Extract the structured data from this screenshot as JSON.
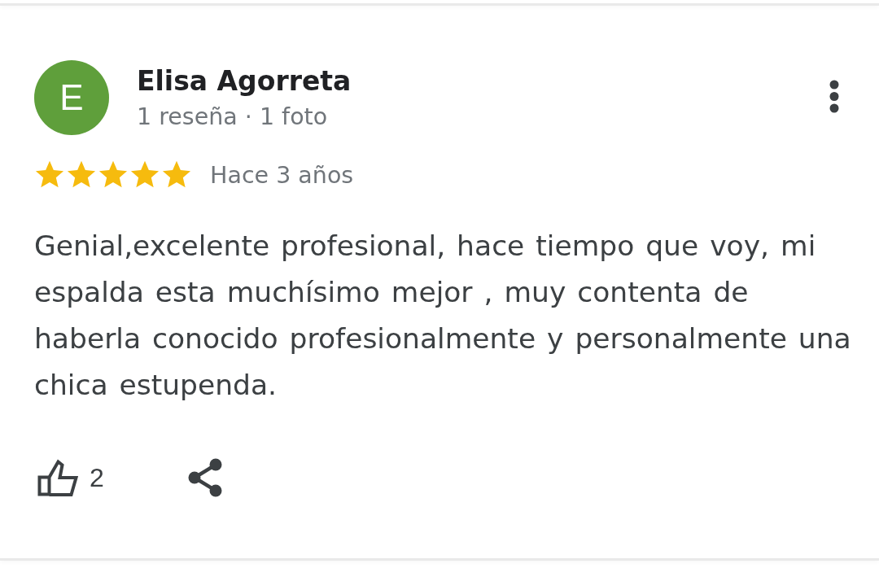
{
  "review": {
    "avatar_initial": "E",
    "name": "Elisa Agorreta",
    "meta": "1 reseña · 1 foto",
    "stars": 5,
    "time": "Hace 3 años",
    "text": "Genial,excelente profesional, hace tiempo que voy, mi espalda esta muchísimo mejor , muy contenta de haberla conocido profesionalmente y personalmente una chica estupenda.",
    "likes": "2"
  }
}
